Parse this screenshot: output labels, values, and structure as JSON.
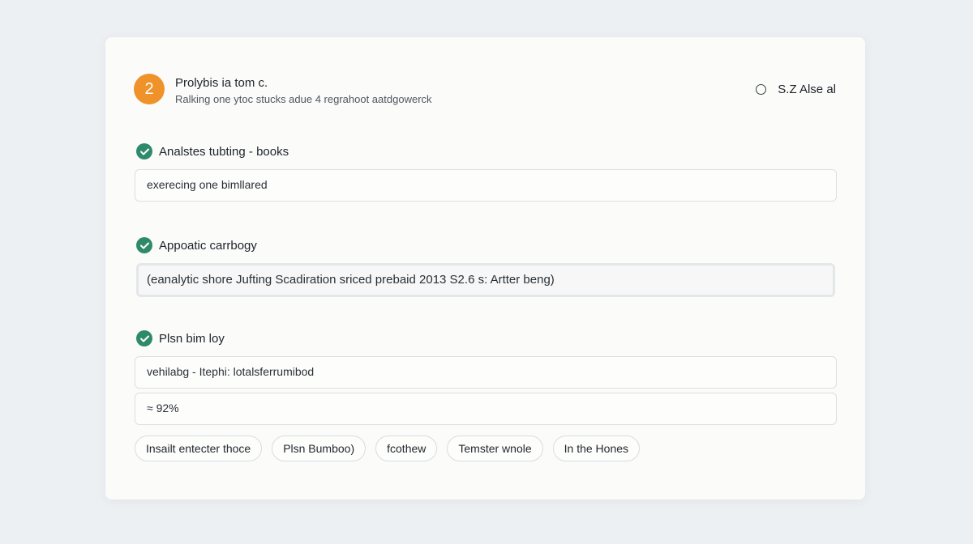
{
  "header": {
    "step_number": "2",
    "title": "Prolybis ia tom c.",
    "subtitle": "Ralking one ytoc stucks adue 4 regrahoot aatdgowerck",
    "radio_label": "S.Z Alse al"
  },
  "sections": [
    {
      "title": "Analstes tubting - books",
      "icon": "check-circle-icon",
      "field_value": "exerecing one bimllared"
    },
    {
      "title": "Appoatic carrbogy",
      "icon": "check-circle-icon",
      "field_value": "(eanalytic shore Jufting Scadiration sriced prebaid 2013 S2.6 s: Artter beng)"
    },
    {
      "title": "Plsn bim loy",
      "icon": "check-circle-icon",
      "field_value": "vehilabg - Itephi: lotalsferrumibod",
      "field_value_2": "≈ 92%"
    }
  ],
  "chips": [
    "Insailt entecter thoce",
    "Plsn Bumboo)",
    "fcothew",
    "Temster wnole",
    "In the Hones"
  ],
  "colors": {
    "accent_orange": "#f0922a",
    "check_green": "#2f8a6b"
  }
}
